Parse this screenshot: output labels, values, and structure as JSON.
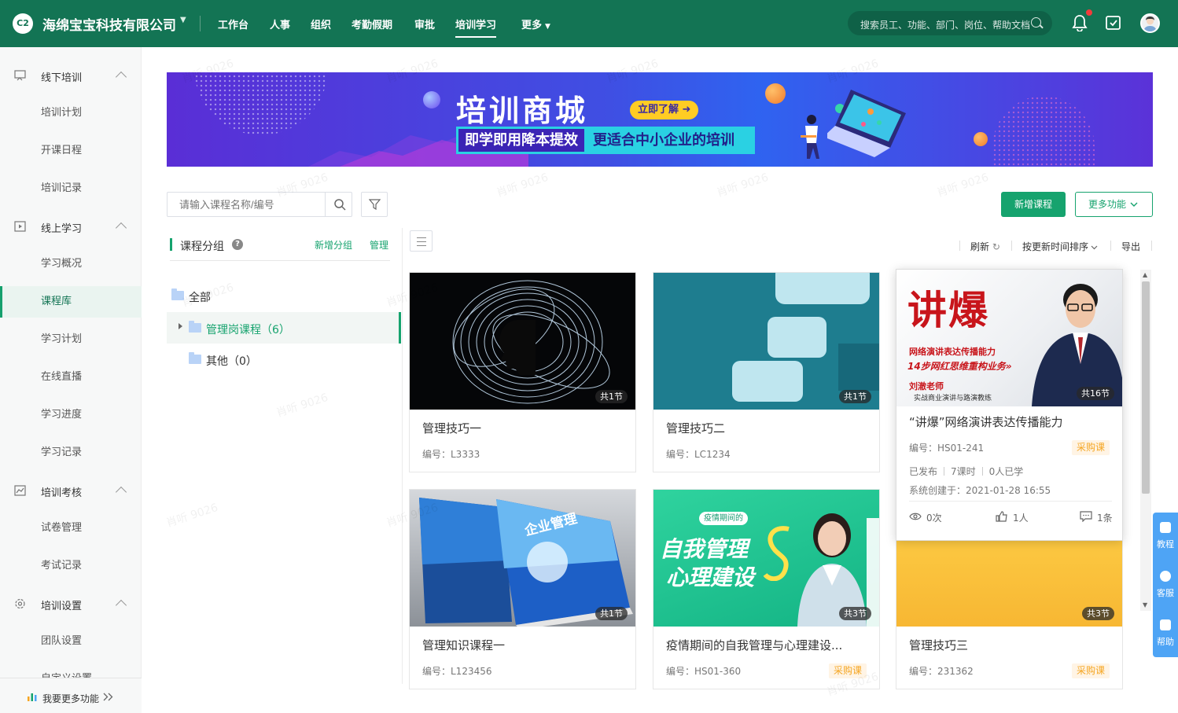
{
  "topbar": {
    "logo_text": "C2",
    "company": "海绵宝宝科技有限公司",
    "nav": [
      "工作台",
      "人事",
      "组织",
      "考勤假期",
      "审批",
      "培训学习",
      "更多"
    ],
    "active_nav": "培训学习",
    "search_placeholder": "搜索员工、功能、部门、岗位、帮助文档"
  },
  "sidebar": {
    "groups": [
      {
        "label": "线下培训",
        "icon": "classroom-icon",
        "items": [
          "培训计划",
          "开课日程",
          "培训记录"
        ]
      },
      {
        "label": "线上学习",
        "icon": "video-icon",
        "items": [
          "学习概况",
          "课程库",
          "学习计划",
          "在线直播",
          "学习进度",
          "学习记录"
        ]
      },
      {
        "label": "培训考核",
        "icon": "exam-icon",
        "items": [
          "试卷管理",
          "考试记录"
        ]
      },
      {
        "label": "培训设置",
        "icon": "settings-icon",
        "items": [
          "团队设置",
          "自定义设置"
        ]
      }
    ],
    "active_item": "课程库",
    "footer": "我要更多功能"
  },
  "banner": {
    "title": "培训商城",
    "cta": "立即了解",
    "slogan_left": "即学即用降本提效",
    "slogan_right": "更适合中小企业的培训"
  },
  "toolbar": {
    "search_placeholder": "请输入课程名称/编号",
    "new_course": "新增课程",
    "more_functions": "更多功能"
  },
  "groups_panel": {
    "title": "课程分组",
    "help": "?",
    "add_group": "新增分组",
    "manage": "管理",
    "tree": [
      {
        "label": "全部"
      },
      {
        "label": "管理岗课程（6）",
        "selected": true
      },
      {
        "label": "其他（0）"
      }
    ]
  },
  "list_toolbar": {
    "refresh": "刷新",
    "sort": "按更新时间排序",
    "export": "导出"
  },
  "courses": [
    {
      "title": "管理技巧一",
      "code": "编号：L3333",
      "sections": "共1节"
    },
    {
      "title": "管理技巧二",
      "code": "编号：LC1234",
      "sections": "共1节"
    },
    {
      "title": "“讲爆”网络演讲表达传播能力",
      "code": "编号：HS01-241",
      "sections": "共16节",
      "tag": "采购课",
      "status": "已发布",
      "hours": "7课时",
      "learners": "0人已学",
      "created": "系统创建于：2021-01-28 16:55",
      "views": "0次",
      "likes": "1人",
      "comments": "1条",
      "cover_big": "讲爆",
      "cover_line1": "网络演讲表达传播能力",
      "cover_line2": "14步网红思维重构业务»",
      "cover_line3": "刘澈老师",
      "cover_line4": "实战商业演讲与路演教练"
    },
    {
      "title": "管理知识课程一",
      "code": "编号：L123456",
      "sections": "共1节",
      "cover_text": "企业管理"
    },
    {
      "title": "疫情期间的自我管理与心理建设...",
      "code": "编号：HS01-360",
      "sections": "共3节",
      "tag": "采购课",
      "cover_badge": "疫情期间的",
      "cover_line1": "自我管理",
      "cover_line2": "心理建设"
    },
    {
      "title": "管理技巧三",
      "code": "编号：231362",
      "sections": "共3节",
      "tag": "采购课"
    }
  ],
  "float_help": [
    "教程",
    "客服",
    "帮助"
  ],
  "watermark": "肖听 9026",
  "colors": {
    "primary": "#137454",
    "accent": "#16a36e",
    "tag": "#f5a623"
  }
}
